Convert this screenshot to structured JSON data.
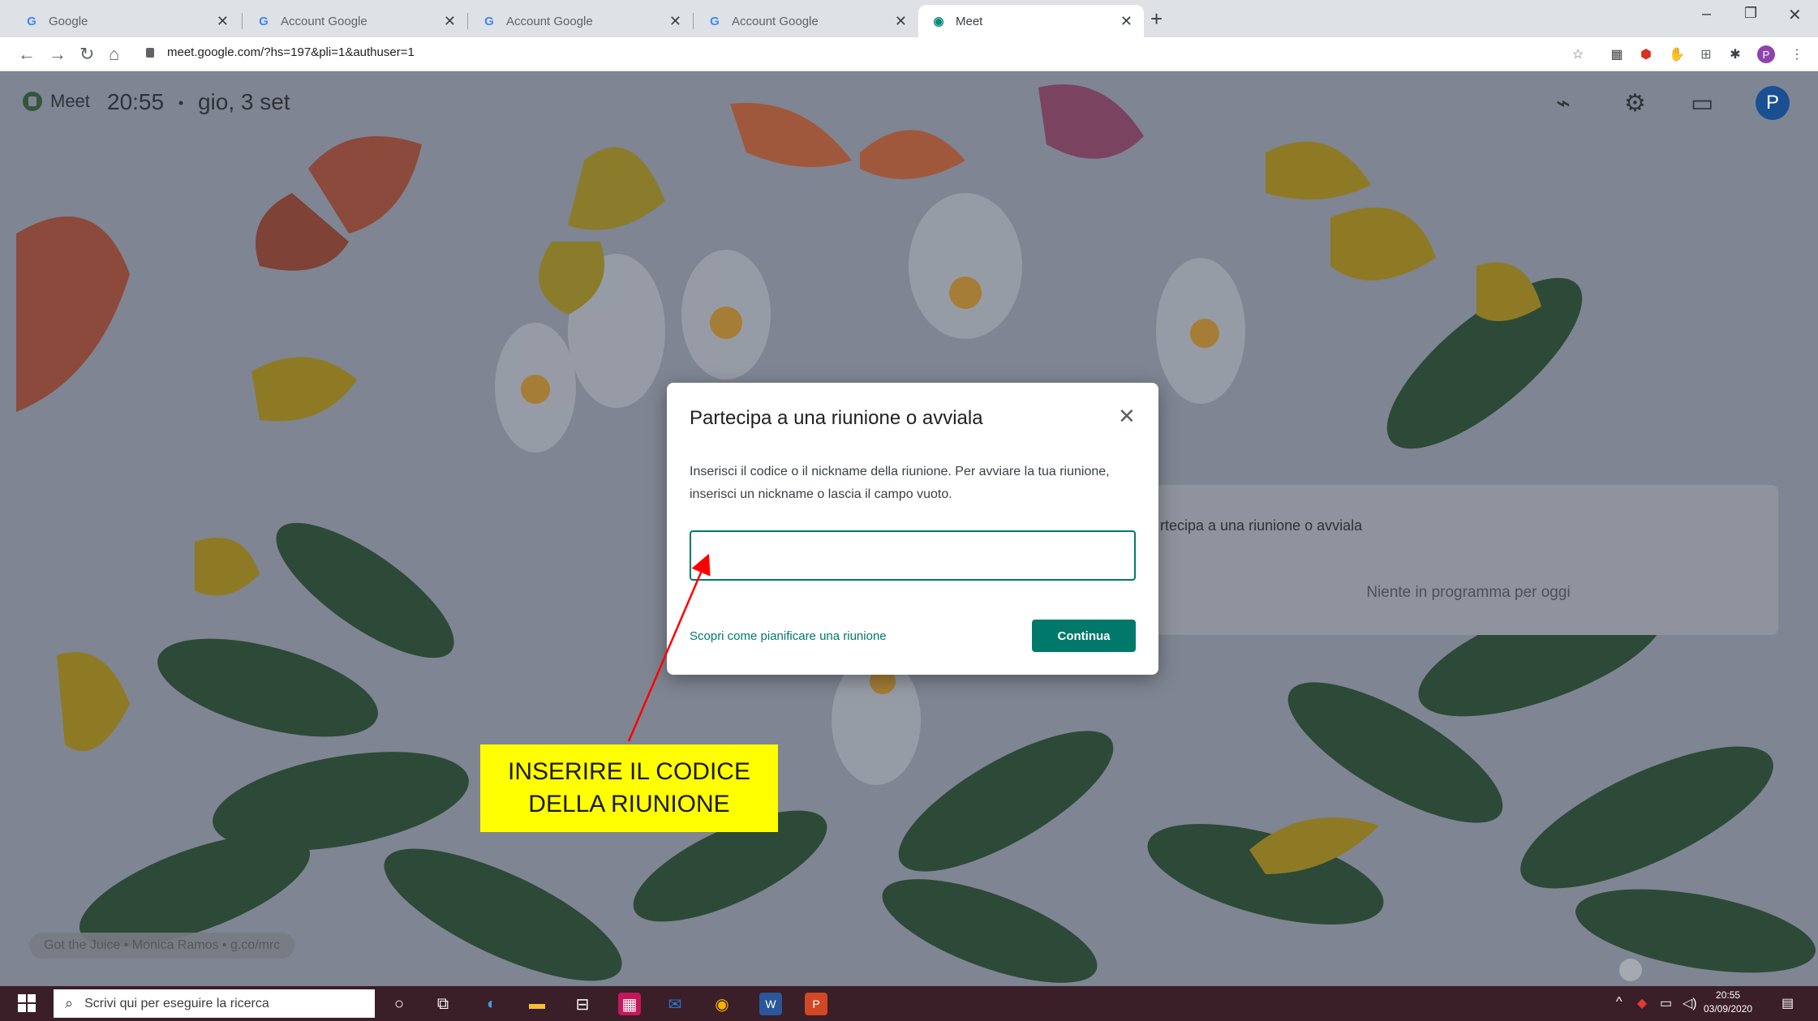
{
  "browser": {
    "tabs": [
      {
        "label": "Google"
      },
      {
        "label": "Account Google"
      },
      {
        "label": "Account Google"
      },
      {
        "label": "Account Google"
      },
      {
        "label": "Meet"
      }
    ],
    "url": "meet.google.com/?hs=197&pli=1&authuser=1",
    "profile_initial": "P"
  },
  "meet": {
    "logo_label": "Meet",
    "time": "20:55",
    "separator": "•",
    "date": "gio, 3 set",
    "avatar_initial": "P",
    "side_card_title": "rtecipa a una riunione o avviala",
    "side_card_empty": "Niente in programma per oggi",
    "credits": "Got the Juice  •  Monica Ramos  •  g.co/mrc"
  },
  "dialog": {
    "title": "Partecipa a una riunione o avviala",
    "description": "Inserisci il codice o il nickname della riunione. Per avviare la tua riunione, inserisci un nickname o lascia il campo vuoto.",
    "input_value": "",
    "input_placeholder": "",
    "link": "Scopri come pianificare una riunione",
    "button": "Continua"
  },
  "annotation": {
    "line1": "INSERIRE IL CODICE",
    "line2": "DELLA RIUNIONE",
    "arrow_color": "#ff0000",
    "box_color": "#ffff00"
  },
  "taskbar": {
    "search_placeholder": "Scrivi qui per eseguire la ricerca",
    "time": "20:55",
    "date": "03/09/2020"
  },
  "colors": {
    "accent": "#00796b",
    "page_overlay": "#7f8592",
    "taskbar": "#3a1e28"
  }
}
